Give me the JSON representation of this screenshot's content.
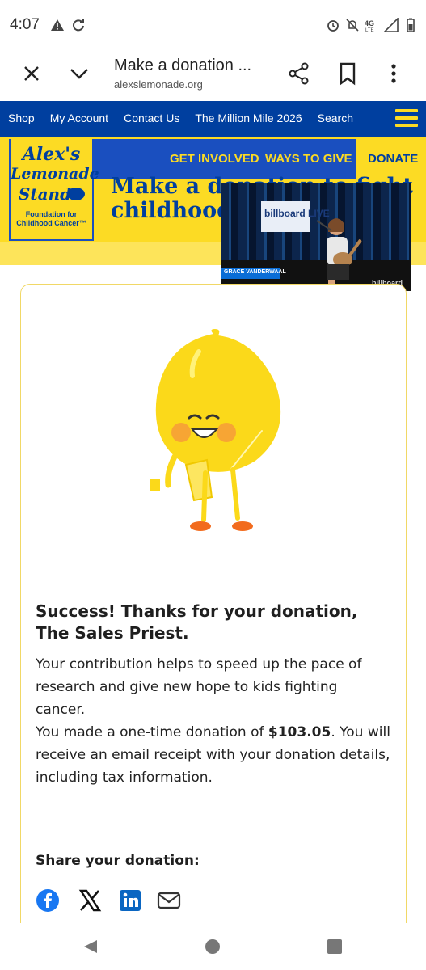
{
  "status_bar": {
    "time": "4:07",
    "icons": [
      "warning-icon",
      "sync-icon",
      "alarm-icon",
      "mute-icon",
      "4g-lte-icon",
      "signal-icon",
      "battery-icon"
    ]
  },
  "browser": {
    "title": "Make a donation ...",
    "url": "alexslemonade.org"
  },
  "top_nav": {
    "items": [
      "Shop",
      "My Account",
      "Contact Us",
      "The Million Mile 2026",
      "Search"
    ]
  },
  "logo": {
    "line1": "Alex's",
    "line2": "Lemonade",
    "line3": "Stand",
    "tagline_1": "Foundation for",
    "tagline_2": "Childhood Cancer™"
  },
  "secondary_nav": {
    "get_involved": "GET INVOLVED",
    "ways_to_give": "WAYS TO GIVE",
    "donate": "DONATE"
  },
  "hero": {
    "title_line1": "Make a donation to fight",
    "title_line2": "childhood cancer"
  },
  "video": {
    "caption": "GRACE VANDERWAAL",
    "brand": "billboard",
    "wall_logo": "billboard LIVE"
  },
  "card": {
    "heading": "Success! Thanks for your donation, The Sales Priest.",
    "paragraph1": "Your contribution helps to speed up the pace of research and give new hope to kids fighting cancer.",
    "paragraph2_prefix": "You made a one-time donation of ",
    "donation_amount": "$103.05",
    "paragraph2_suffix": ". You will receive an email receipt with your donation details, including tax information.",
    "share_label": "Share your donation:",
    "share_icons": [
      "facebook-icon",
      "x-icon",
      "linkedin-icon",
      "email-icon"
    ]
  },
  "colors": {
    "brand_blue": "#003f9f",
    "brand_yellow": "#fcdb24",
    "facebook_blue": "#1877f2",
    "linkedin_blue": "#0a66c2"
  }
}
